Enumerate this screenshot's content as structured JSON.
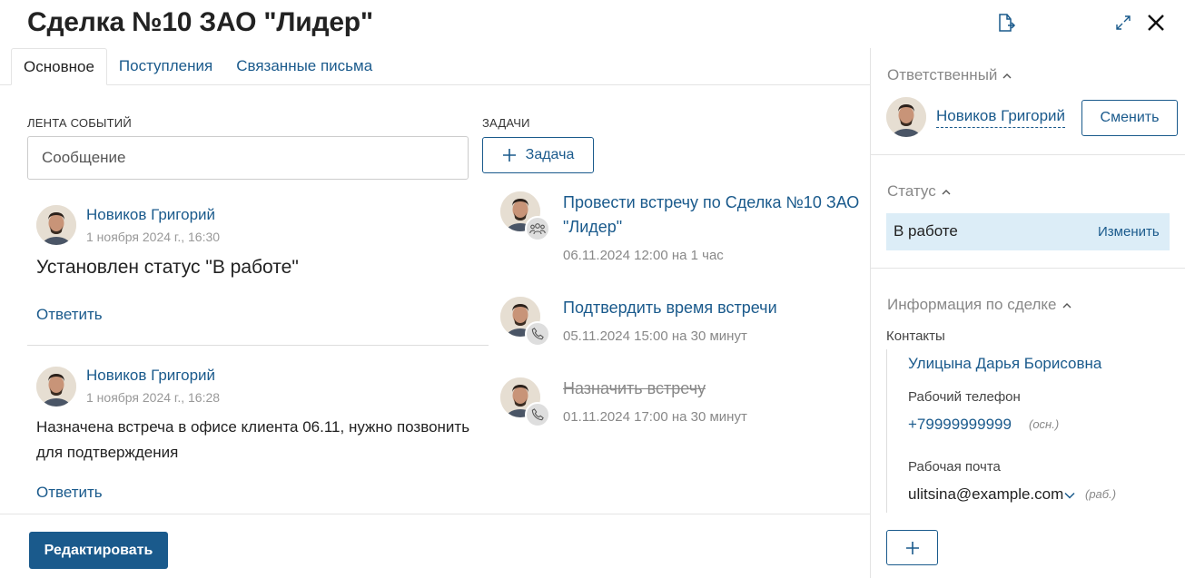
{
  "header": {
    "title": "Сделка №10 ЗАО \"Лидер\""
  },
  "tabs": [
    {
      "label": "Основное",
      "active": true
    },
    {
      "label": "Поступления",
      "active": false
    },
    {
      "label": "Связанные письма",
      "active": false
    }
  ],
  "feed": {
    "section_label": "ЛЕНТА СОБЫТИЙ",
    "input_placeholder": "Сообщение",
    "events": [
      {
        "author": "Новиков Григорий",
        "date": "1 ноября 2024 г., 16:30",
        "text": "Установлен статус \"В работе\"",
        "reply_label": "Ответить"
      },
      {
        "author": "Новиков Григорий",
        "date": "1 ноября 2024 г., 16:28",
        "text": "Назначена встреча в офисе клиента 06.11, нужно позвонить для подтверждения",
        "reply_label": "Ответить"
      }
    ]
  },
  "tasks": {
    "section_label": "ЗАДАЧИ",
    "add_label": "Задача",
    "items": [
      {
        "title": "Провести встречу по Сделка №10 ЗАО \"Лидер\"",
        "meta": "06.11.2024 12:00 на 1 час",
        "icon": "group-icon",
        "done": false
      },
      {
        "title": "Подтвердить время встречи",
        "meta": "05.11.2024 15:00 на 30 минут",
        "icon": "phone-icon",
        "done": false
      },
      {
        "title": "Назначить встречу",
        "meta": "01.11.2024 17:00 на 30 минут",
        "icon": "phone-icon",
        "done": true
      }
    ]
  },
  "footer": {
    "edit_label": "Редактировать"
  },
  "sidebar": {
    "responsible": {
      "heading": "Ответственный",
      "name": "Новиков Григорий",
      "change_label": "Сменить"
    },
    "status": {
      "heading": "Статус",
      "value": "В работе",
      "change_label": "Изменить"
    },
    "info": {
      "heading": "Информация по сделке",
      "contacts_label": "Контакты",
      "contact_name": "Улицына Дарья Борисовна",
      "phone_label": "Рабочий телефон",
      "phone": "+79999999999",
      "phone_tag": "(осн.)",
      "email_label": "Рабочая почта",
      "email": "ulitsina@example.com",
      "email_tag": "(раб.)"
    }
  }
}
